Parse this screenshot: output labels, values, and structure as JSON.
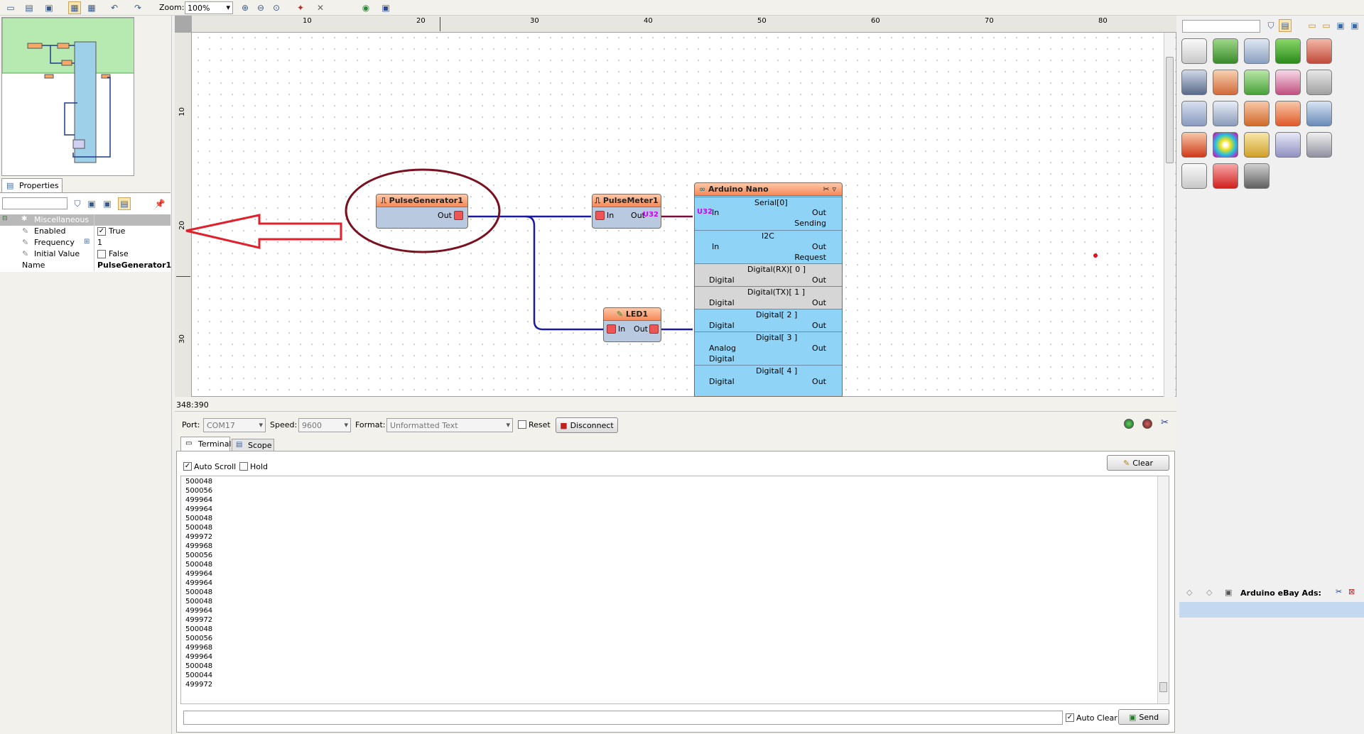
{
  "toolbar": {
    "zoom_label": "Zoom:",
    "zoom_value": "100%"
  },
  "canvas": {
    "ruler_h": [
      "10",
      "20",
      "30",
      "40",
      "50",
      "60",
      "70",
      "80"
    ],
    "ruler_v": [
      "10",
      "20",
      "30"
    ],
    "status": "348:390",
    "components": {
      "pulse_generator": {
        "title": "PulseGenerator1",
        "out": "Out"
      },
      "pulse_meter": {
        "title": "PulseMeter1",
        "in": "In",
        "out": "Out",
        "out_badge": "U32"
      },
      "led": {
        "title": "LED1",
        "in": "In",
        "out": "Out"
      },
      "arduino": {
        "title": "Arduino Nano",
        "sections": [
          {
            "label": "Serial[0]",
            "left": "In",
            "left_badge": "U32",
            "right": [
              "Out",
              "Sending"
            ]
          },
          {
            "label": "I2C",
            "left": "In",
            "right": [
              "Out",
              "Request"
            ]
          },
          {
            "label": "Digital(RX)[ 0 ]",
            "left": "Digital",
            "right": [
              "Out"
            ]
          },
          {
            "label": "Digital(TX)[ 1 ]",
            "left": "Digital",
            "right": [
              "Out"
            ]
          },
          {
            "label": "Digital[ 2 ]",
            "left": "Digital",
            "right": [
              "Out"
            ]
          },
          {
            "label": "Digital[ 3 ]",
            "left": "Analog",
            "left2": "Digital",
            "right": [
              "Out"
            ]
          },
          {
            "label": "Digital[ 4 ]",
            "left": "Digital",
            "right": [
              "Out"
            ]
          }
        ]
      }
    }
  },
  "properties": {
    "tab_label": "Properties",
    "category": "Miscellaneous",
    "rows": [
      {
        "name": "Enabled",
        "value": "True",
        "checked": true
      },
      {
        "name": "Frequency",
        "value": "1"
      },
      {
        "name": "Initial Value",
        "value": "False",
        "checked": false
      },
      {
        "name": "Name",
        "value": "PulseGenerator1"
      }
    ]
  },
  "serial": {
    "port_label": "Port:",
    "port_value": "COM17",
    "speed_label": "Speed:",
    "speed_value": "9600",
    "format_label": "Format:",
    "format_value": "Unformatted Text",
    "reset_label": "Reset",
    "disconnect_label": "Disconnect",
    "tabs": [
      "Terminal",
      "Scope"
    ],
    "auto_scroll_label": "Auto Scroll",
    "hold_label": "Hold",
    "clear_label": "Clear",
    "auto_clear_label": "Auto Clear",
    "send_label": "Send",
    "lines": [
      "500048",
      "500056",
      "499964",
      "499964",
      "500048",
      "500048",
      "499972",
      "499968",
      "500056",
      "500048",
      "499964",
      "499964",
      "500048",
      "500048",
      "499964",
      "499972",
      "500048",
      "500056",
      "499968",
      "499964",
      "500048",
      "500044",
      "499972"
    ]
  },
  "ads": {
    "title": "Arduino eBay Ads:"
  }
}
